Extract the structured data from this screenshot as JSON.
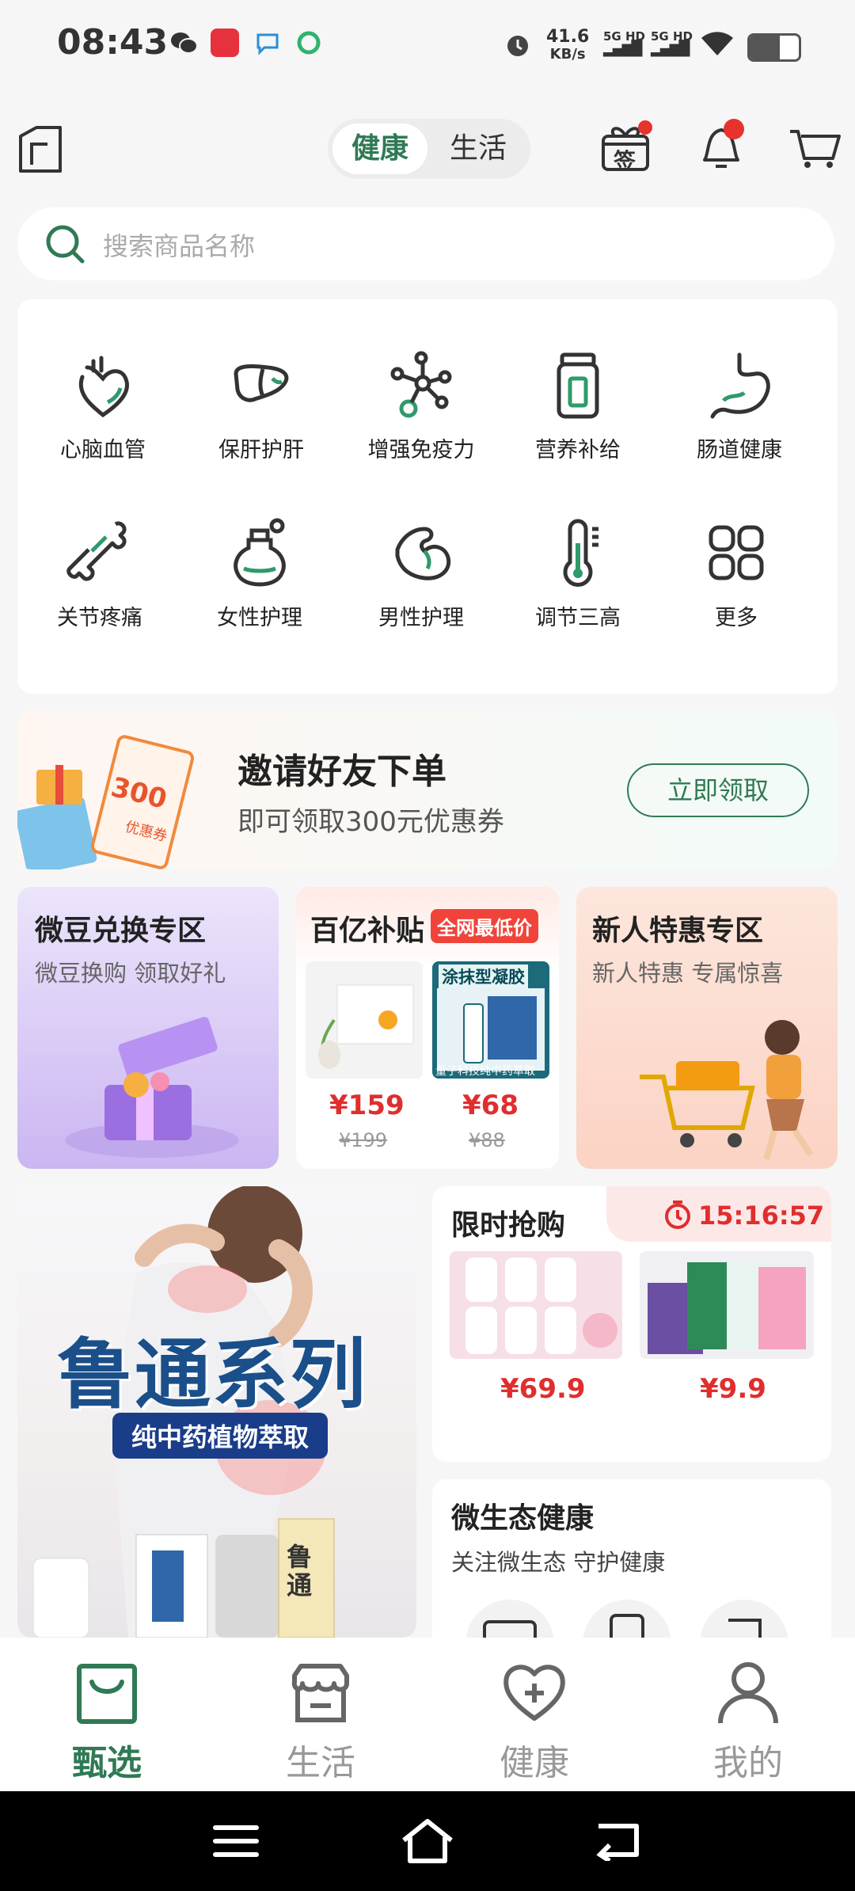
{
  "status_bar": {
    "time": "08:43",
    "speed_value": "41.6",
    "speed_unit": "KB/s",
    "sim1": "5G HD",
    "sim2": "5G HD"
  },
  "header": {
    "tabs": [
      "健康",
      "生活"
    ],
    "active_tab": "健康",
    "sign_icon_label": "签"
  },
  "search": {
    "placeholder": "搜索商品名称"
  },
  "categories": [
    {
      "label": "心脑血管",
      "icon": "heart-organ-icon"
    },
    {
      "label": "保肝护肝",
      "icon": "liver-icon"
    },
    {
      "label": "增强免疫力",
      "icon": "molecule-icon"
    },
    {
      "label": "营养补给",
      "icon": "supplement-bottle-icon"
    },
    {
      "label": "肠道健康",
      "icon": "stomach-icon"
    },
    {
      "label": "关节疼痛",
      "icon": "bone-joint-icon"
    },
    {
      "label": "女性护理",
      "icon": "perfume-bottle-icon"
    },
    {
      "label": "男性护理",
      "icon": "muscle-arm-icon"
    },
    {
      "label": "调节三高",
      "icon": "thermometer-icon"
    },
    {
      "label": "更多",
      "icon": "grid-more-icon"
    }
  ],
  "invite": {
    "title": "邀请好友下单",
    "subtitle": "即可领取300元优惠券",
    "button": "立即领取",
    "coupon_value": "300",
    "coupon_label": "优惠券"
  },
  "promos": {
    "weidou": {
      "title": "微豆兑换专区",
      "subtitle": "微豆换购 领取好礼"
    },
    "subsidy": {
      "title": "百亿补贴",
      "badge": "全网最低价",
      "products": [
        {
          "price": "¥159",
          "original": "¥199"
        },
        {
          "price": "¥68",
          "original": "¥88",
          "box_title": "涂抹型凝胶",
          "box_caption": "量子科技纯中药萃取"
        }
      ]
    },
    "newcomer": {
      "title": "新人特惠专区",
      "subtitle": "新人特惠 专属惊喜"
    }
  },
  "banner": {
    "title": "鲁通系列",
    "subtitle": "纯中药植物萃取",
    "box_text": "鲁通"
  },
  "flash_sale": {
    "title": "限时抢购",
    "countdown": "15:16:57",
    "products": [
      {
        "price": "¥69.9"
      },
      {
        "price": "¥9.9"
      }
    ]
  },
  "eco": {
    "title": "微生态健康",
    "subtitle": "关注微生态 守护健康"
  },
  "nav": [
    {
      "label": "甄选",
      "icon": "shopping-bag-icon",
      "active": true
    },
    {
      "label": "生活",
      "icon": "store-icon",
      "active": false
    },
    {
      "label": "健康",
      "icon": "heart-plus-icon",
      "active": false
    },
    {
      "label": "我的",
      "icon": "user-icon",
      "active": false
    }
  ],
  "colors": {
    "accent": "#2f7a54",
    "price_red": "#e02e2e",
    "badge_red": "#f0443a"
  }
}
